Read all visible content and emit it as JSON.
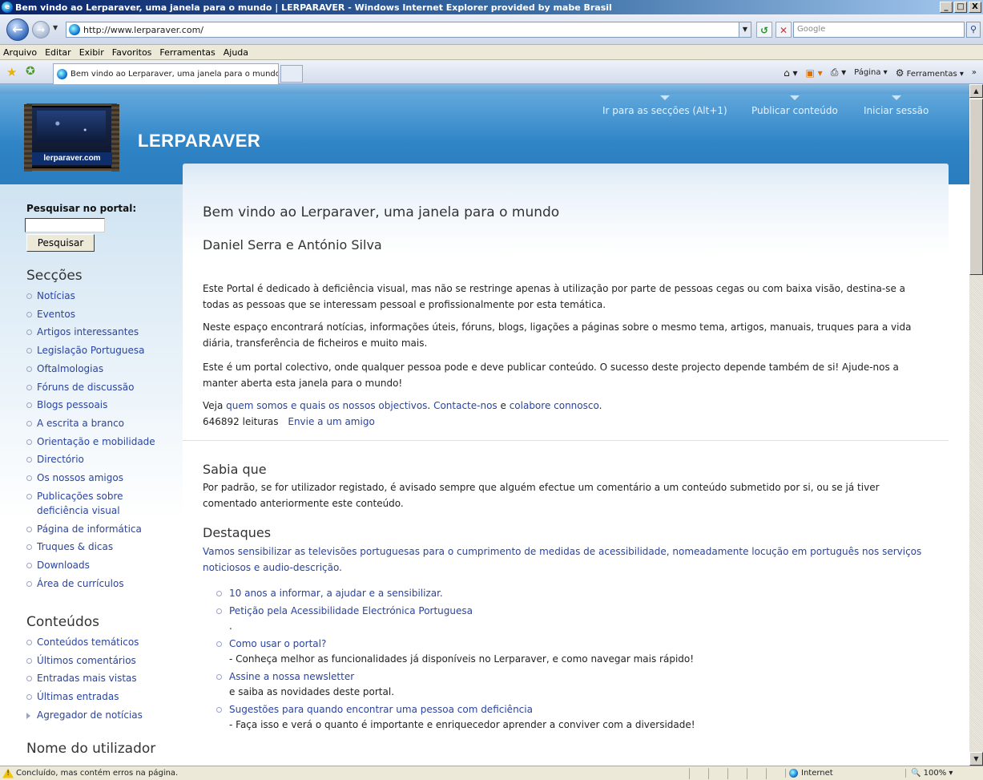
{
  "window": {
    "title": "Bem vindo ao Lerparaver, uma janela para o mundo | LERPARAVER - Windows Internet Explorer provided by mabe Brasil",
    "min": "_",
    "max": "□",
    "close": "X"
  },
  "address": {
    "url": "http://www.lerparaver.com/",
    "search_placeholder": "Google"
  },
  "menu": [
    "Arquivo",
    "Editar",
    "Exibir",
    "Favoritos",
    "Ferramentas",
    "Ajuda"
  ],
  "tab": {
    "title": "Bem vindo ao Lerparaver, uma janela para o mundo | ..."
  },
  "commandbar": {
    "page": "Página",
    "tools": "Ferramentas"
  },
  "site": {
    "logo_text": "lerparaver.com",
    "name": "LERPARAVER",
    "toplinks": [
      "Ir para as secções (Alt+1)",
      "Publicar conteúdo",
      "Iniciar sessão"
    ]
  },
  "sidebar": {
    "search_label": "Pesquisar no portal:",
    "search_button": "Pesquisar",
    "sections_title": "Secções",
    "sections": [
      "Notícias",
      "Eventos",
      "Artigos interessantes",
      "Legislação Portuguesa",
      "Oftalmologias",
      "Fóruns de discussão",
      "Blogs pessoais",
      "A escrita a branco",
      "Orientação e mobilidade",
      "Directório",
      "Os nossos amigos"
    ],
    "sections_multiline": [
      "Publicações sobre",
      "deficiência visual"
    ],
    "sections_after": [
      "Página de informática",
      "Truques & dicas",
      "Downloads",
      "Área de currículos"
    ],
    "contents_title": "Conteúdos",
    "contents": [
      "Conteúdos temáticos",
      "Últimos comentários",
      "Entradas mais vistas",
      "Últimas entradas"
    ],
    "aggregator": "Agregador de notícias",
    "username_title": "Nome do utilizador"
  },
  "main": {
    "title": "Bem vindo ao Lerparaver, uma janela para o mundo",
    "authors": "Daniel Serra e António Silva",
    "p1": "Este Portal é dedicado à deficiência visual, mas não se restringe apenas à utilização por parte de pessoas cegas ou com baixa visão, destina-se a todas as pessoas que se interessam pessoal e profissionalmente por esta temática.",
    "p2": "Neste espaço encontrará notícias, informações úteis, fóruns, blogs, ligações a páginas sobre o mesmo tema, artigos, manuais, truques para a vida diária, transferência de ficheiros e muito mais.",
    "p3": "Este é um portal colectivo, onde qualquer pessoa pode e deve publicar conteúdo. O sucesso deste projecto depende também de si! Ajude-nos a manter aberta esta janela para o mundo!",
    "p4_prefix": "Veja ",
    "p4_link1": "quem somos e quais os nossos objectivos",
    "p4_mid": ". ",
    "p4_link2": "Contacte-nos",
    "p4_and": " e ",
    "p4_link3": "colabore connosco",
    "p4_end": ".",
    "reads": "646892 leituras",
    "send_friend": "Envie a um amigo",
    "did_you_know_title": "Sabia que",
    "did_you_know": "Por padrão, se for utilizador registado, é avisado sempre que alguém efectue um comentário a um conteúdo submetido por si, ou se já tiver comentado anteriormente este conteúdo.",
    "highlights_title": "Destaques",
    "highlights_intro": "Vamos sensibilizar as televisões portuguesas para o cumprimento de medidas de acessibilidade, nomeadamente locução em português nos serviços noticiosos e audio-descrição.",
    "highlights": [
      {
        "title": "10 anos a informar, a ajudar e a sensibilizar.",
        "desc": ""
      },
      {
        "title": "Petição pela Acessibilidade Electrónica Portuguesa",
        "desc": "."
      },
      {
        "title": "Como usar o portal?",
        "desc": "- Conheça melhor as funcionalidades já disponíveis no Lerparaver, e como navegar mais rápido!"
      },
      {
        "title": "Assine a nossa newsletter",
        "desc": "e saiba as novidades deste portal."
      },
      {
        "title": "Sugestões para quando encontrar uma pessoa com deficiência",
        "desc": "- Faça isso e verá o quanto é importante e enriquecedor aprender a conviver com a diversidade!"
      }
    ]
  },
  "status": {
    "text": "Concluído, mas contém erros na página.",
    "zone": "Internet",
    "zoom": "100%"
  }
}
